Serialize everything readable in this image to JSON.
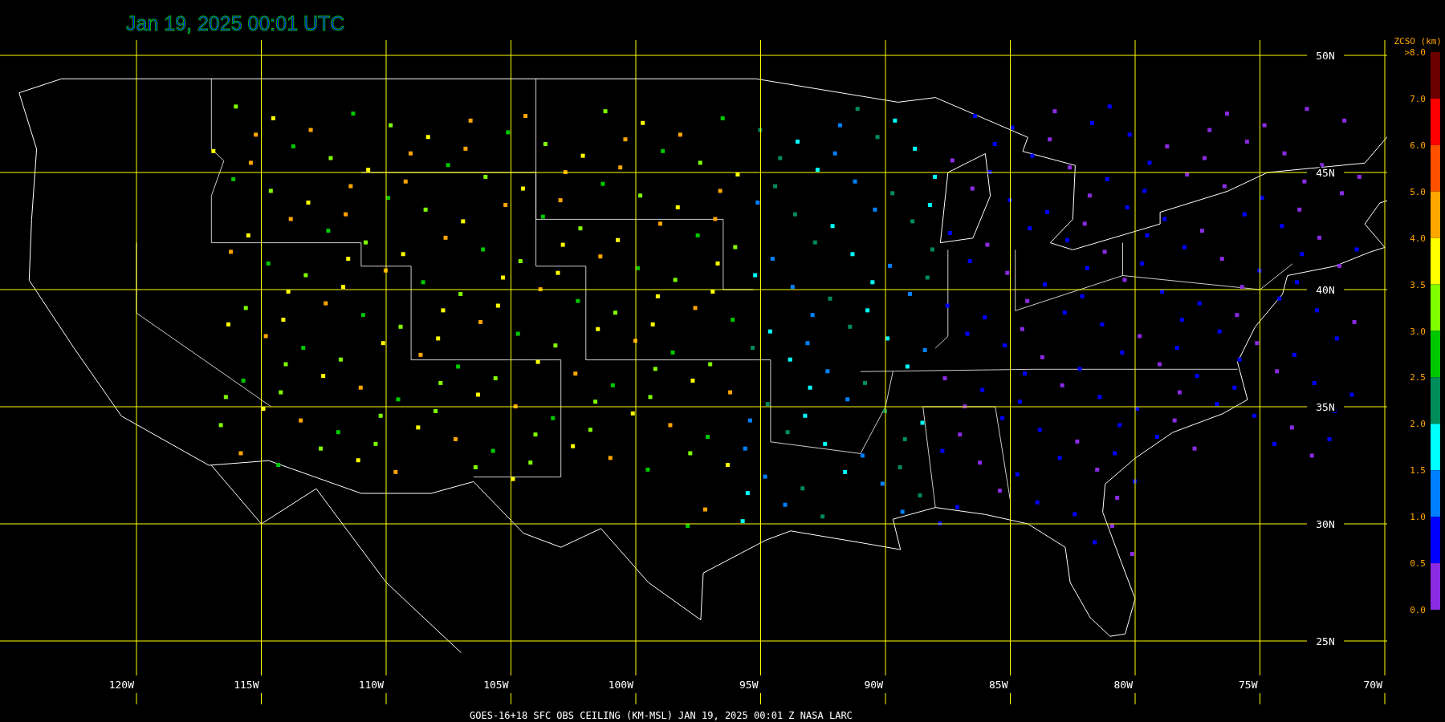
{
  "title": "Jan 19, 2025 00:01 UTC",
  "lat_labels": [
    "50N",
    "45N",
    "40N",
    "35N",
    "30N",
    "25N"
  ],
  "lon_labels": [
    "120W",
    "115W",
    "110W",
    "105W",
    "100W",
    "95W",
    "90W",
    "85W",
    "80W",
    "75W",
    "70W"
  ],
  "legend": {
    "title": "ZCSO (km)",
    "labels": [
      ">8.0",
      "7.0",
      "6.0",
      "5.0",
      "4.0",
      "3.5",
      "3.0",
      "2.5",
      "2.0",
      "1.5",
      "1.0",
      "0.5",
      "0.0"
    ],
    "bins": [
      {
        "color": "#6b0000"
      },
      {
        "color": "#ff0000"
      },
      {
        "color": "#ff5000"
      },
      {
        "color": "#ffa500"
      },
      {
        "color": "#ffff00"
      },
      {
        "color": "#80ff00"
      },
      {
        "color": "#00c800"
      },
      {
        "color": "#008c5a"
      },
      {
        "color": "#00ffff"
      },
      {
        "color": "#0080ff"
      },
      {
        "color": "#0000ff"
      },
      {
        "color": "#8a2be2"
      }
    ]
  },
  "footer": "GOES-16+18  SFC OBS CEILING (KM-MSL)   JAN 19, 2025 00:01 Z   NASA LARC"
}
